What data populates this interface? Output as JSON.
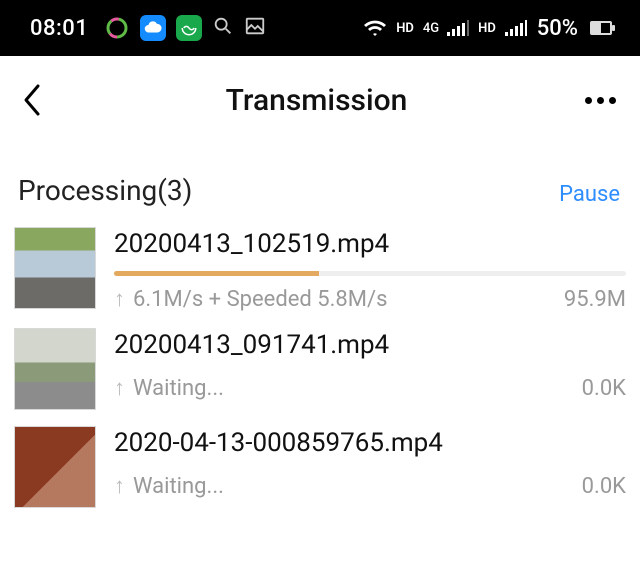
{
  "status_bar": {
    "time": "08:01",
    "battery_text": "50%",
    "hd1": "HD",
    "net_top": "4G",
    "net_bottom": "↑↓",
    "hd2": "HD"
  },
  "header": {
    "title": "Transmission"
  },
  "section": {
    "label": "Processing(3)",
    "action": "Pause"
  },
  "items": [
    {
      "name": "20200413_102519.mp4",
      "speed": "6.1M/s + Speeded 5.8M/s",
      "size": "95.9M",
      "progress_pct": 40
    },
    {
      "name": "20200413_091741.mp4",
      "speed": "Waiting...",
      "size": "0.0K",
      "progress_pct": 0
    },
    {
      "name": "2020-04-13-000859765.mp4",
      "speed": "Waiting...",
      "size": "0.0K",
      "progress_pct": 0
    }
  ]
}
